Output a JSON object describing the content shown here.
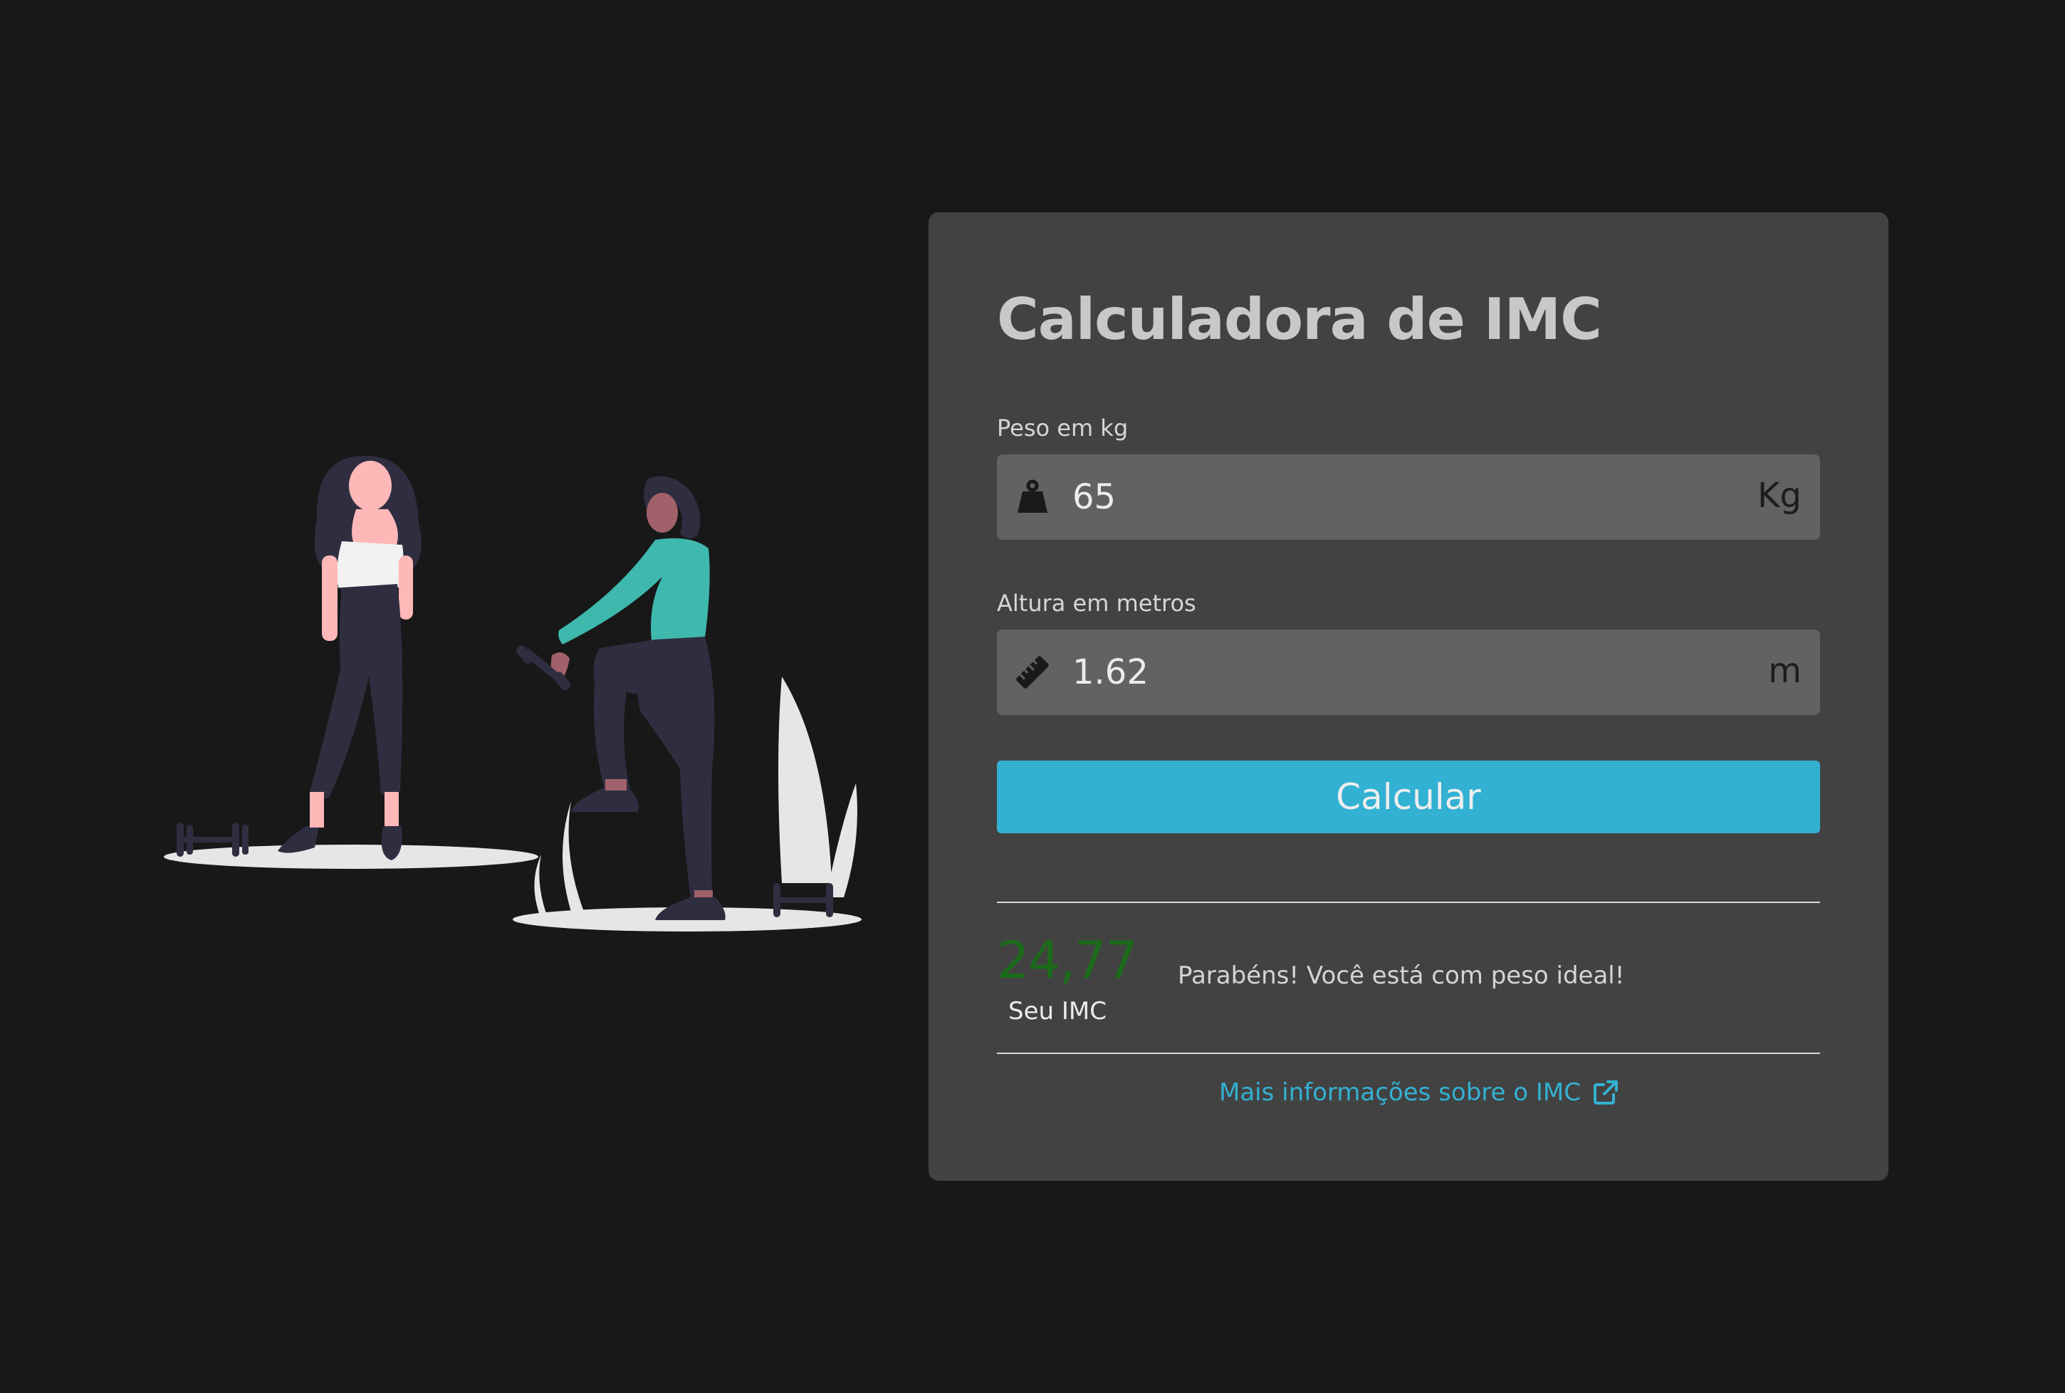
{
  "title": "Calculadora de IMC",
  "weight": {
    "label": "Peso em kg",
    "value": "65",
    "unit": "Kg",
    "icon": "weight-icon"
  },
  "height": {
    "label": "Altura em metros",
    "value": "1.62",
    "unit": "m",
    "icon": "ruler-icon"
  },
  "button": {
    "label": "Calcular"
  },
  "result": {
    "value": "24,77",
    "label": "Seu IMC",
    "message": "Parabéns! Você está com peso ideal!",
    "value_color": "#1b6b1b"
  },
  "link": {
    "label": "Mais informações sobre o IMC",
    "icon": "external-link-icon"
  },
  "colors": {
    "background": "#181818",
    "card": "#424242",
    "input": "#626262",
    "accent": "#33b1d3"
  }
}
